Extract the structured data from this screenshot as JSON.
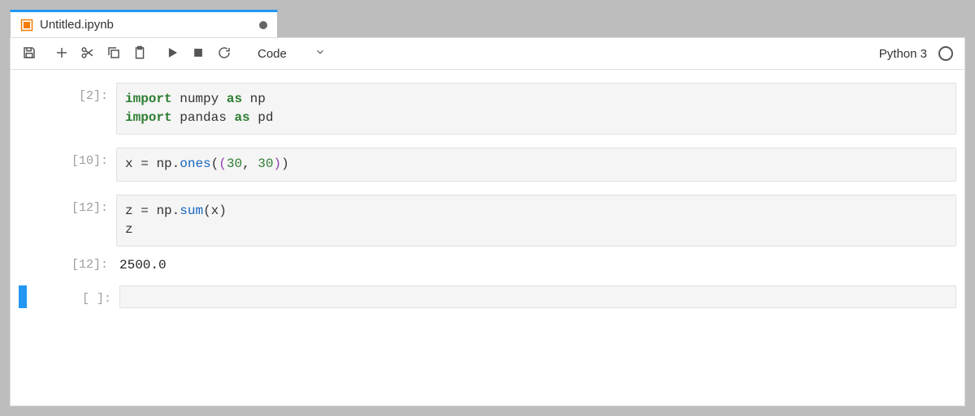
{
  "tab": {
    "title": "Untitled.ipynb",
    "dirty": true
  },
  "toolbar": {
    "cell_type": "Code",
    "kernel_name": "Python 3"
  },
  "cells": [
    {
      "prompt": "[2]:",
      "code": {
        "line1": {
          "kw1": "import",
          "mod1": "numpy",
          "kw2": "as",
          "alias1": "np"
        },
        "line2": {
          "kw1": "import",
          "mod1": "pandas",
          "kw2": "as",
          "alias1": "pd"
        }
      }
    },
    {
      "prompt": "[10]:",
      "code": {
        "line1": {
          "lhs": "x",
          "op": "=",
          "ns": "np",
          "dot": ".",
          "fn": "ones",
          "lp1": "(",
          "lp2": "(",
          "n1": "30",
          "comma": ",",
          "sp": " ",
          "n2": "30",
          "rp2": ")",
          "rp1": ")"
        }
      }
    },
    {
      "prompt": "[12]:",
      "code": {
        "line1": {
          "lhs": "z",
          "op": "=",
          "ns": "np",
          "dot": ".",
          "fn": "sum",
          "lp": "(",
          "arg": "x",
          "rp": ")"
        },
        "line2": {
          "expr": "z"
        }
      },
      "out_prompt": "[12]:",
      "output": "2500.0"
    },
    {
      "prompt": "[ ]:",
      "active": true,
      "empty": true
    }
  ]
}
